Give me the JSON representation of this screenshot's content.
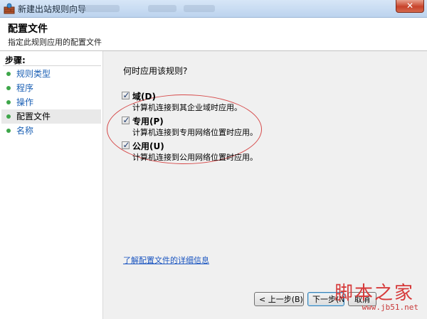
{
  "window": {
    "title": "新建出站规则向导",
    "close_glyph": "✕",
    "icon": "firewall-rule-icon"
  },
  "header": {
    "title": "配置文件",
    "subtitle": "指定此规则应用的配置文件"
  },
  "steps": {
    "title": "步骤:",
    "items": [
      {
        "label": "规则类型"
      },
      {
        "label": "程序"
      },
      {
        "label": "操作"
      },
      {
        "label": "配置文件",
        "current": true
      },
      {
        "label": "名称"
      }
    ]
  },
  "main": {
    "question": "何时应用该规则?",
    "options": [
      {
        "label": "域(D)",
        "description": "计算机连接到其企业域时应用。",
        "checked": true
      },
      {
        "label": "专用(P)",
        "description": "计算机连接到专用网络位置时应用。",
        "checked": true
      },
      {
        "label": "公用(U)",
        "description": "计算机连接到公用网络位置时应用。",
        "checked": true
      }
    ],
    "learn_more_link": "了解配置文件的详细信息"
  },
  "buttons": {
    "back": "< 上一步(B)",
    "next": "下一步(N)",
    "cancel": "取消"
  },
  "watermark": {
    "text": "脚本之家",
    "url": "www.jb51.net"
  },
  "colors": {
    "link": "#1a55c0",
    "step_bullet": "#3ea64a",
    "annotation_circle": "#d64a4a",
    "close_button": "#c7432a"
  }
}
